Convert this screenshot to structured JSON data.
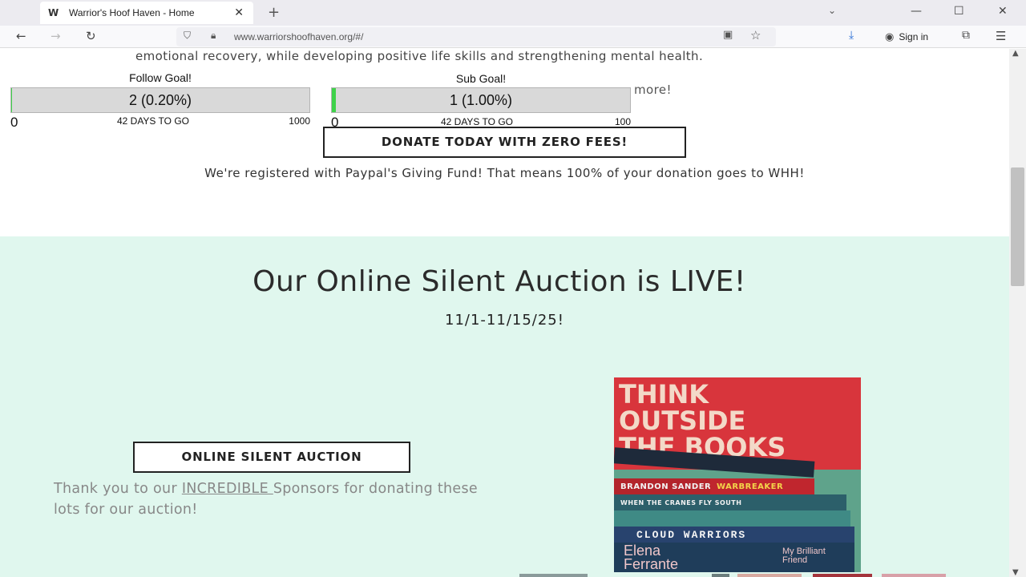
{
  "browser": {
    "tab_title": "Warrior's Hoof Haven - Home",
    "url": "www.warriorshoofhaven.org/#/",
    "signin_label": "Sign in"
  },
  "intro": {
    "text": "emotional recovery, while developing positive life skills and strengthening mental health."
  },
  "goals": {
    "follow": {
      "label": "Follow Goal!",
      "value_text": "2 (0.20%)",
      "progress_percent": 0.2,
      "min": "0",
      "days": "42 DAYS TO GO",
      "max": "1000"
    },
    "sub": {
      "label": "Sub Goal!",
      "value_text": "1 (1.00%)",
      "progress_percent": 1.0,
      "min": "0",
      "days": "42 DAYS TO GO",
      "max": "100"
    },
    "behind_text_right": "more!"
  },
  "donate": {
    "button_label": "DONATE TODAY WITH ZERO FEES!",
    "paypal_text": "We're registered with Paypal's Giving Fund! That means 100% of your donation goes to WHH!"
  },
  "auction": {
    "title": "Our Online Silent Auction is LIVE!",
    "dates": "11/1-11/15/25!",
    "button_label": "ONLINE SILENT AUCTION",
    "thanks_prefix": "Thank you to our ",
    "thanks_link": "INCREDIBLE ",
    "thanks_suffix": "Sponsors for donating these lots for our auction!",
    "photo": {
      "sign_lines": [
        "THINK",
        "OUTSIDE",
        "THE BOOKS"
      ],
      "book_titles": [
        "BRANDON SANDERSON",
        "WARBREAKER",
        "WHEN THE CRANES FLY SOUTH",
        "CLOUD WARRIORS",
        "Elena Ferrante",
        "My Brilliant Friend"
      ]
    }
  },
  "colors": {
    "auction_bg": "#e0f7ee",
    "progress_fill": "#3fd24a",
    "bar_bg": "#d9d9d9"
  }
}
